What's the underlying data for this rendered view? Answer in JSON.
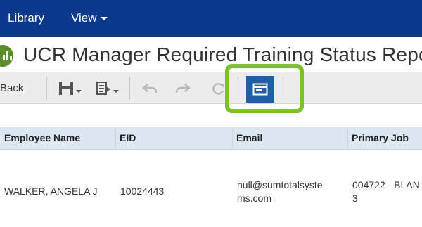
{
  "nav": {
    "library": "Library",
    "view": "View"
  },
  "page": {
    "title": "UCR Manager Required Training Status Report"
  },
  "toolbar": {
    "back": "Back"
  },
  "table": {
    "headers": [
      "Employee Name",
      "EID",
      "Email",
      "Primary Job"
    ],
    "rows": [
      {
        "employee_name": "WALKER, ANGELA J",
        "eid": "10024443",
        "email_line1": "null@sumtotalsyste",
        "email_line2": "ms.com",
        "primary_job_line1": "004722 - BLAN",
        "primary_job_line2": "3"
      }
    ]
  },
  "colors": {
    "nav_background": "#0b3a8c",
    "toolbar_active": "#1f5fa8",
    "highlight": "#7cc12a",
    "report_icon": "#5b8e2a",
    "header_background": "#dde7f1"
  },
  "icons": [
    "report-chart-icon",
    "save-icon",
    "export-icon",
    "undo-icon",
    "redo-icon",
    "refresh-icon",
    "layout-view-icon"
  ]
}
